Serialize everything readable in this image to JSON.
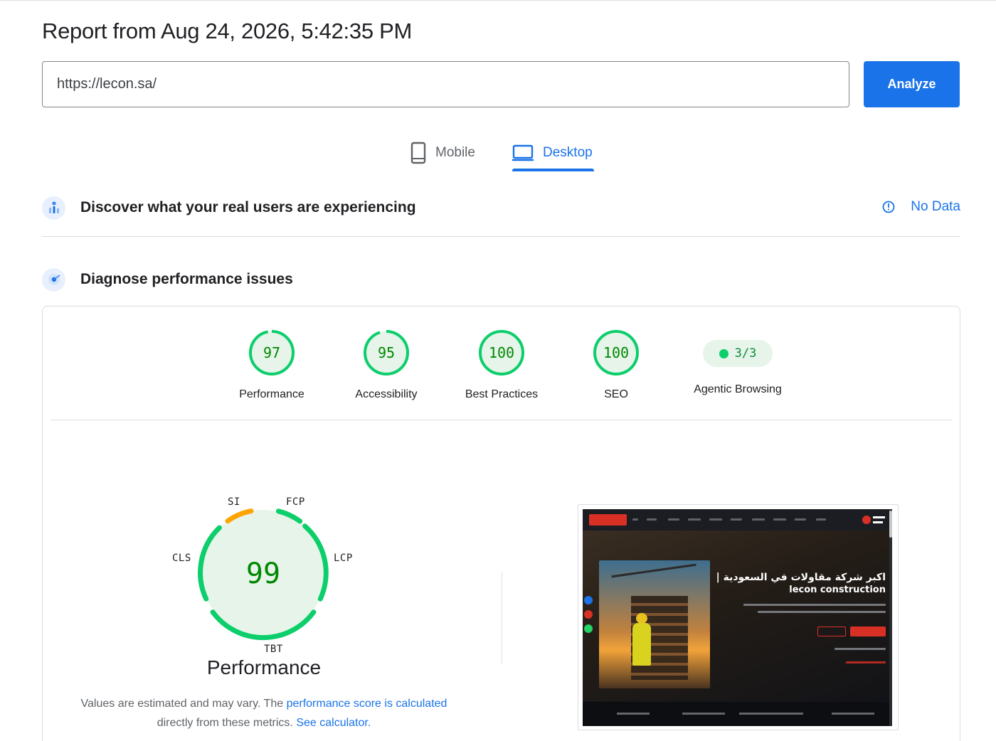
{
  "report": {
    "title": "Report from Aug 24, 2026, 5:42:35 PM"
  },
  "url_input": {
    "value": "https://lecon.sa/"
  },
  "analyze_button": {
    "label": "Analyze"
  },
  "device_tabs": [
    {
      "label": "Mobile",
      "icon": "smartphone-icon",
      "selected": false
    },
    {
      "label": "Desktop",
      "icon": "laptop-icon",
      "selected": true
    }
  ],
  "discover": {
    "title": "Discover what your real users are experiencing",
    "status": "No Data",
    "icon": "users-chart-icon",
    "status_icon": "info-icon"
  },
  "diagnose": {
    "title": "Diagnose performance issues",
    "icon": "lighthouse-icon"
  },
  "scores": [
    {
      "value": "97",
      "label": "Performance",
      "fraction": 0.97
    },
    {
      "value": "95",
      "label": "Accessibility",
      "fraction": 0.95
    },
    {
      "value": "100",
      "label": "Best Practices",
      "fraction": 1.0
    },
    {
      "value": "100",
      "label": "SEO",
      "fraction": 1.0
    }
  ],
  "agentic": {
    "value": "3/3",
    "label": "Agentic Browsing"
  },
  "performance_detail": {
    "score": "99",
    "title": "Performance",
    "metrics": {
      "si": "SI",
      "fcp": "FCP",
      "lcp": "LCP",
      "tbt": "TBT",
      "cls": "CLS"
    },
    "note_prefix": "Values are estimated and may vary. The ",
    "note_link1": "performance score is calculated",
    "note_mid": " directly from these metrics. ",
    "note_link2": "See calculator."
  },
  "screenshot": {
    "hero_arabic": "اكبر شركة مقاولات في السعودية |",
    "hero_english": "lecon construction"
  },
  "colors": {
    "accent": "#1a73e8",
    "pass_green": "#0cce6b",
    "pass_text": "#008800",
    "average_orange": "#ffa400",
    "pass_fill": "#e6f4ea"
  }
}
